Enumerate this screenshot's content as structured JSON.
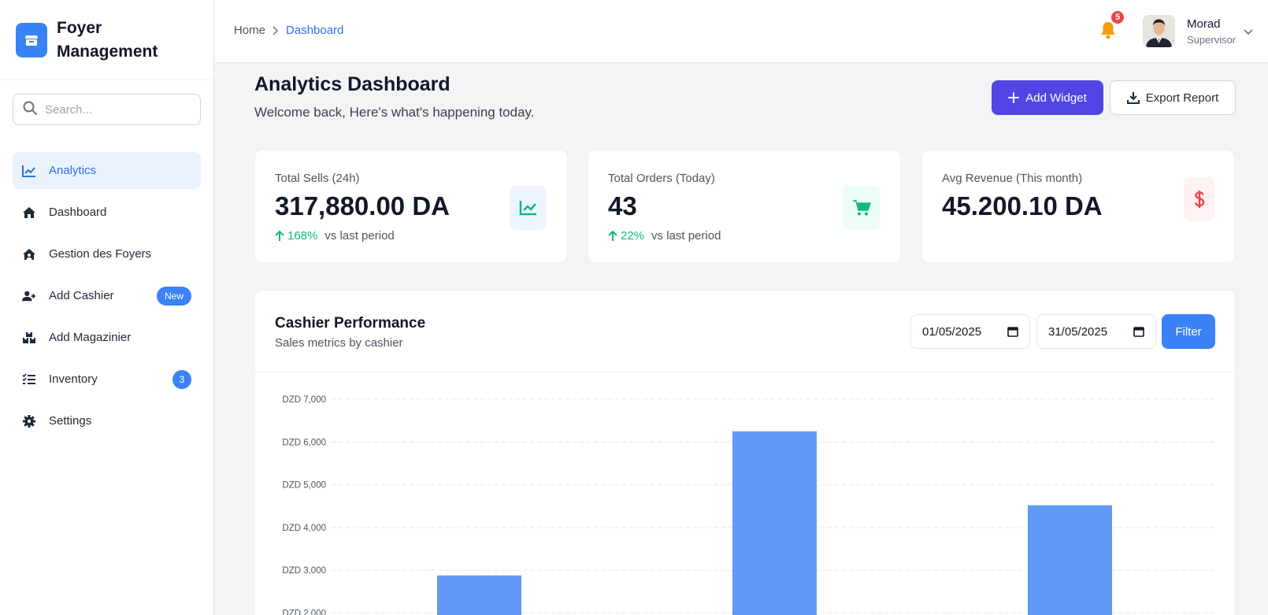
{
  "brand": {
    "name": "Foyer Management",
    "color": "#3b82f6"
  },
  "search": {
    "placeholder": "Search..."
  },
  "sidebar": {
    "items": [
      {
        "label": "Analytics",
        "icon": "chart-line-icon",
        "active": true
      },
      {
        "label": "Dashboard",
        "icon": "home-icon"
      },
      {
        "label": "Gestion des Foyers",
        "icon": "house-user-icon"
      },
      {
        "label": "Add Cashier",
        "icon": "user-plus-icon",
        "badge": "New"
      },
      {
        "label": "Add Magazinier",
        "icon": "boxes-icon"
      },
      {
        "label": "Inventory",
        "icon": "list-check-icon",
        "badge": "3"
      },
      {
        "label": "Settings",
        "icon": "gear-icon"
      }
    ]
  },
  "breadcrumb": {
    "home": "Home",
    "current": "Dashboard"
  },
  "notifications": {
    "count": "5"
  },
  "user": {
    "name": "Morad",
    "role": "Supervisor"
  },
  "header": {
    "title": "Analytics Dashboard",
    "subtitle": "Welcome back, Here's what's happening today.",
    "add_widget": "Add Widget",
    "export_report": "Export Report"
  },
  "stats": [
    {
      "label": "Total Sells (24h)",
      "value": "317,880.00 DA",
      "change": "168%",
      "vs": "vs last period",
      "icon": "chart-line-icon",
      "icon_color": "#10b981",
      "icon_bg": "#eef4fd"
    },
    {
      "label": "Total Orders (Today)",
      "value": "43",
      "change": "22%",
      "vs": "vs last period",
      "icon": "cart-icon",
      "icon_color": "#10b981",
      "icon_bg": "#ecfdf5"
    },
    {
      "label": "Avg Revenue (This month)",
      "value": "45.200.10 DA",
      "icon": "dollar-icon",
      "icon_color": "#ef4444",
      "icon_bg": "#fef2f2"
    }
  ],
  "performance": {
    "title": "Cashier Performance",
    "subtitle": "Sales metrics by cashier",
    "date_from": "01/05/2025",
    "date_to": "31/05/2025",
    "filter_label": "Filter"
  },
  "chart_data": {
    "type": "bar",
    "categories": [
      "",
      "",
      ""
    ],
    "values": [
      2880,
      6250,
      4520
    ],
    "ylim": [
      2000,
      7000
    ],
    "yticks": [
      "DZD 7,000",
      "DZD 6,000",
      "DZD 5,000",
      "DZD 4,000",
      "DZD 3,000",
      "DZD 2,000"
    ],
    "grid": true,
    "bar_color": "#6199f6"
  }
}
